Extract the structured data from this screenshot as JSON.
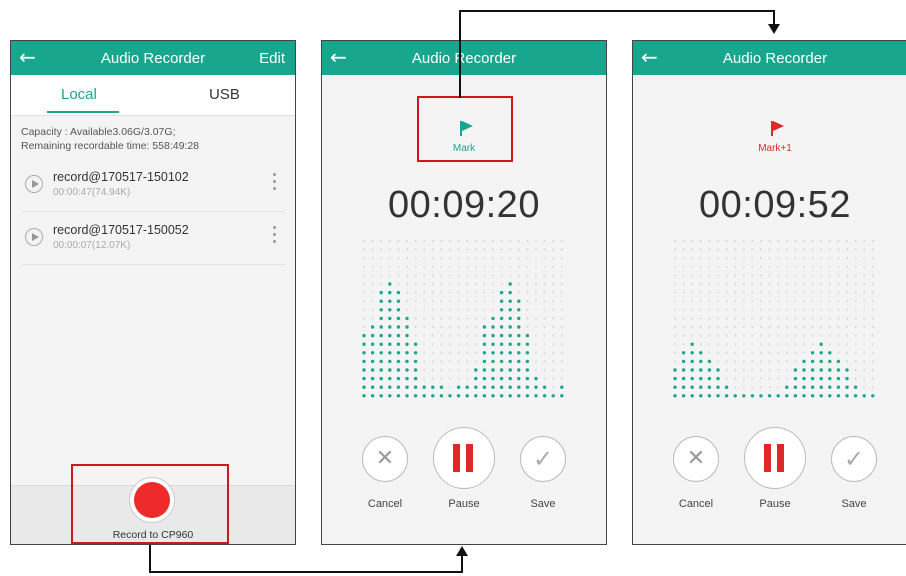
{
  "screen1": {
    "title": "Audio Recorder",
    "edit_label": "Edit",
    "tabs": [
      {
        "label": "Local"
      },
      {
        "label": "USB"
      }
    ],
    "capacity_line": "Capacity : Available3.06G/3.07G;",
    "remaining_line": "Remaining recordable time: 558:49:28",
    "recordings": [
      {
        "name": "record@170517-150102",
        "meta": "00:00:47(74.94K)"
      },
      {
        "name": "record@170517-150052",
        "meta": "00:00:07(12.07K)"
      }
    ],
    "record_label": "Record to CP960"
  },
  "screen2": {
    "title": "Audio Recorder",
    "mark_label": "Mark",
    "timer": "00:09:20",
    "buttons": {
      "cancel": "Cancel",
      "pause": "Pause",
      "save": "Save"
    }
  },
  "screen3": {
    "title": "Audio Recorder",
    "mark_label": "Mark+1",
    "timer": "00:09:52",
    "buttons": {
      "cancel": "Cancel",
      "pause": "Pause",
      "save": "Save"
    }
  },
  "colors": {
    "accent": "#19a68e",
    "record_red": "#ee2a2a",
    "highlight": "#d0171c",
    "wave_active": "#19a68e",
    "wave_idle": "#dcdcdc"
  },
  "icons": {
    "back": "arrow-left-icon",
    "flag": "flag-icon",
    "cancel": "close-icon",
    "save": "check-icon",
    "pause": "pause-icon",
    "play": "play-icon"
  }
}
